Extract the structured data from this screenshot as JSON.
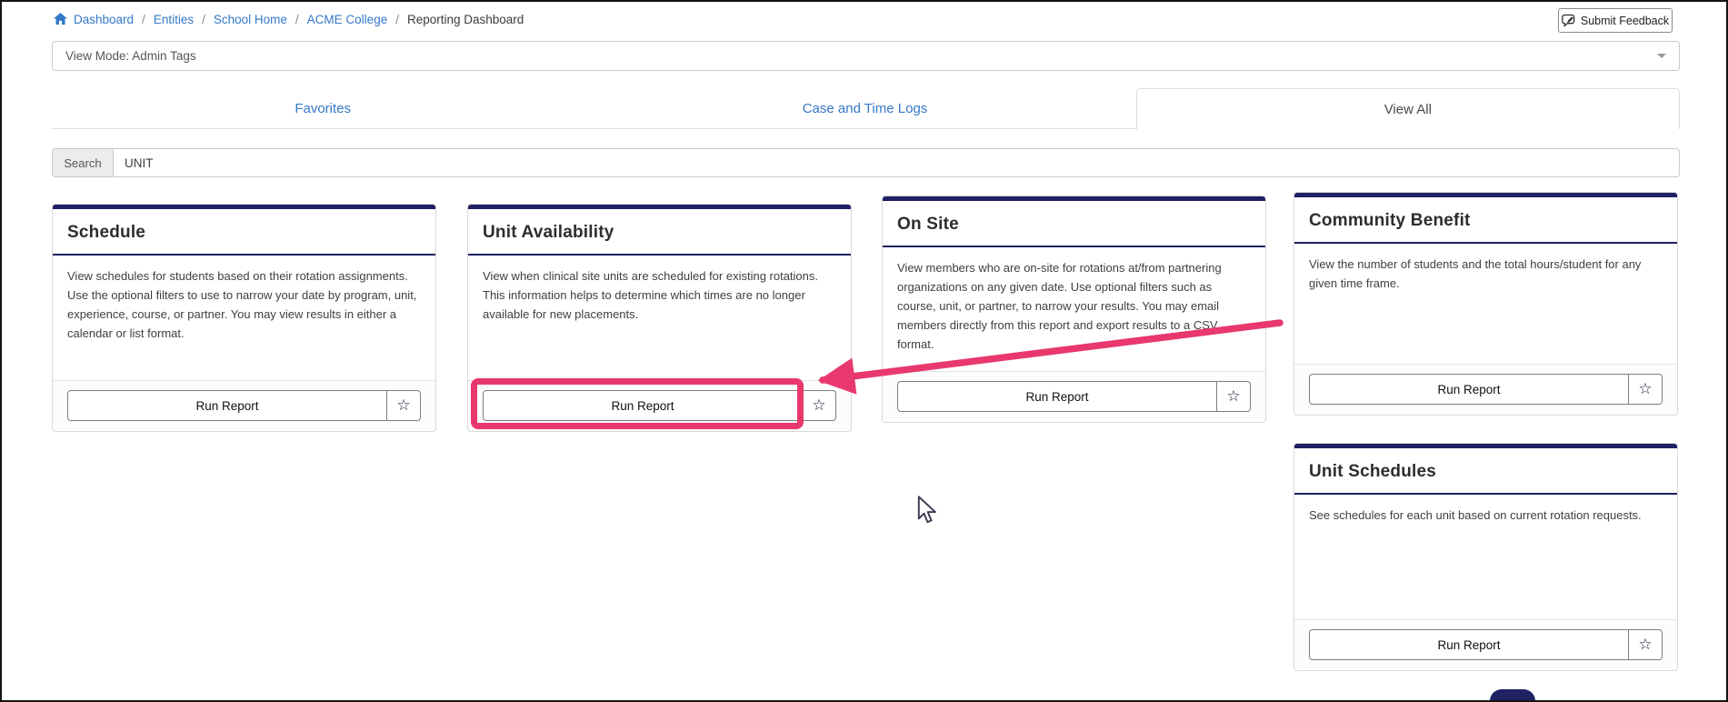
{
  "colors": {
    "accent_navy": "#1f2163",
    "link_blue": "#3578c8",
    "annotation_pink": "#e8386d"
  },
  "header": {
    "breadcrumb": {
      "separator": "/",
      "items": [
        {
          "label": "Dashboard"
        },
        {
          "label": "Entities"
        },
        {
          "label": "School Home"
        },
        {
          "label": "ACME College"
        }
      ],
      "current": "Reporting Dashboard"
    },
    "submit_feedback_label": "Submit Feedback"
  },
  "view_mode": {
    "value": "View Mode: Admin Tags"
  },
  "tabs": [
    {
      "label": "Favorites",
      "active": false
    },
    {
      "label": "Case and Time Logs",
      "active": false
    },
    {
      "label": "View All",
      "active": true
    }
  ],
  "search": {
    "label": "Search",
    "value": "UNIT"
  },
  "cards": [
    {
      "title": "Schedule",
      "description": "View schedules for students based on their rotation assignments. Use the optional filters to use to narrow your date by program, unit, experience, course, or partner. You may view results in either a calendar or list format.",
      "run_label": "Run Report"
    },
    {
      "title": "Unit Availability",
      "description": "View when clinical site units are scheduled for existing rotations. This information helps to determine which times are no longer available for new placements.",
      "run_label": "Run Report"
    },
    {
      "title": "On Site",
      "description": "View members who are on-site for rotations at/from partnering organizations on any given date. Use optional filters such as course, unit, or partner, to narrow your results. You may email members directly from this report and export results to a CSV format.",
      "run_label": "Run Report"
    },
    {
      "title": "Community Benefit",
      "description": "View the number of students and the total hours/student for any given time frame.",
      "run_label": "Run Report"
    },
    {
      "title": "Unit Schedules",
      "description": "See schedules for each unit based on current rotation requests.",
      "run_label": "Run Report"
    }
  ],
  "icons": {
    "star": "☆"
  }
}
